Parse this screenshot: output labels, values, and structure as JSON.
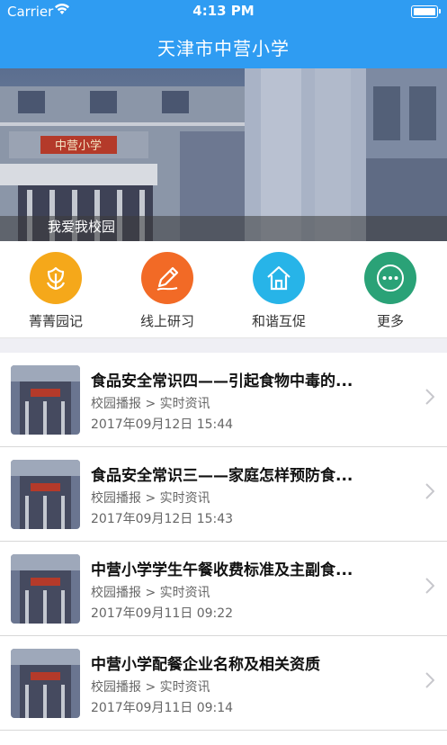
{
  "status_bar": {
    "carrier": "Carrier",
    "time": "4:13 PM"
  },
  "nav": {
    "title": "天津市中营小学"
  },
  "banner": {
    "caption": "我爱我校园",
    "sign_text": "中营小学"
  },
  "menu": [
    {
      "label": "菁菁园记",
      "icon": "tulip-icon",
      "color": "#f5a81a"
    },
    {
      "label": "线上研习",
      "icon": "pencil-icon",
      "color": "#f26a26"
    },
    {
      "label": "和谐互促",
      "icon": "house-icon",
      "color": "#27b4e8"
    },
    {
      "label": "更多",
      "icon": "more-icon",
      "color": "#2aa277"
    }
  ],
  "news": [
    {
      "title": "食品安全常识四——引起食物中毒的...",
      "category": "校园播报 > 实时资讯",
      "date": "2017年09月12日 15:44"
    },
    {
      "title": "食品安全常识三——家庭怎样预防食...",
      "category": "校园播报 > 实时资讯",
      "date": "2017年09月12日 15:43"
    },
    {
      "title": "中营小学学生午餐收费标准及主副食...",
      "category": "校园播报 > 实时资讯",
      "date": "2017年09月11日 09:22"
    },
    {
      "title": "中营小学配餐企业名称及相关资质",
      "category": "校园播报 > 实时资讯",
      "date": "2017年09月11日 09:14"
    }
  ]
}
